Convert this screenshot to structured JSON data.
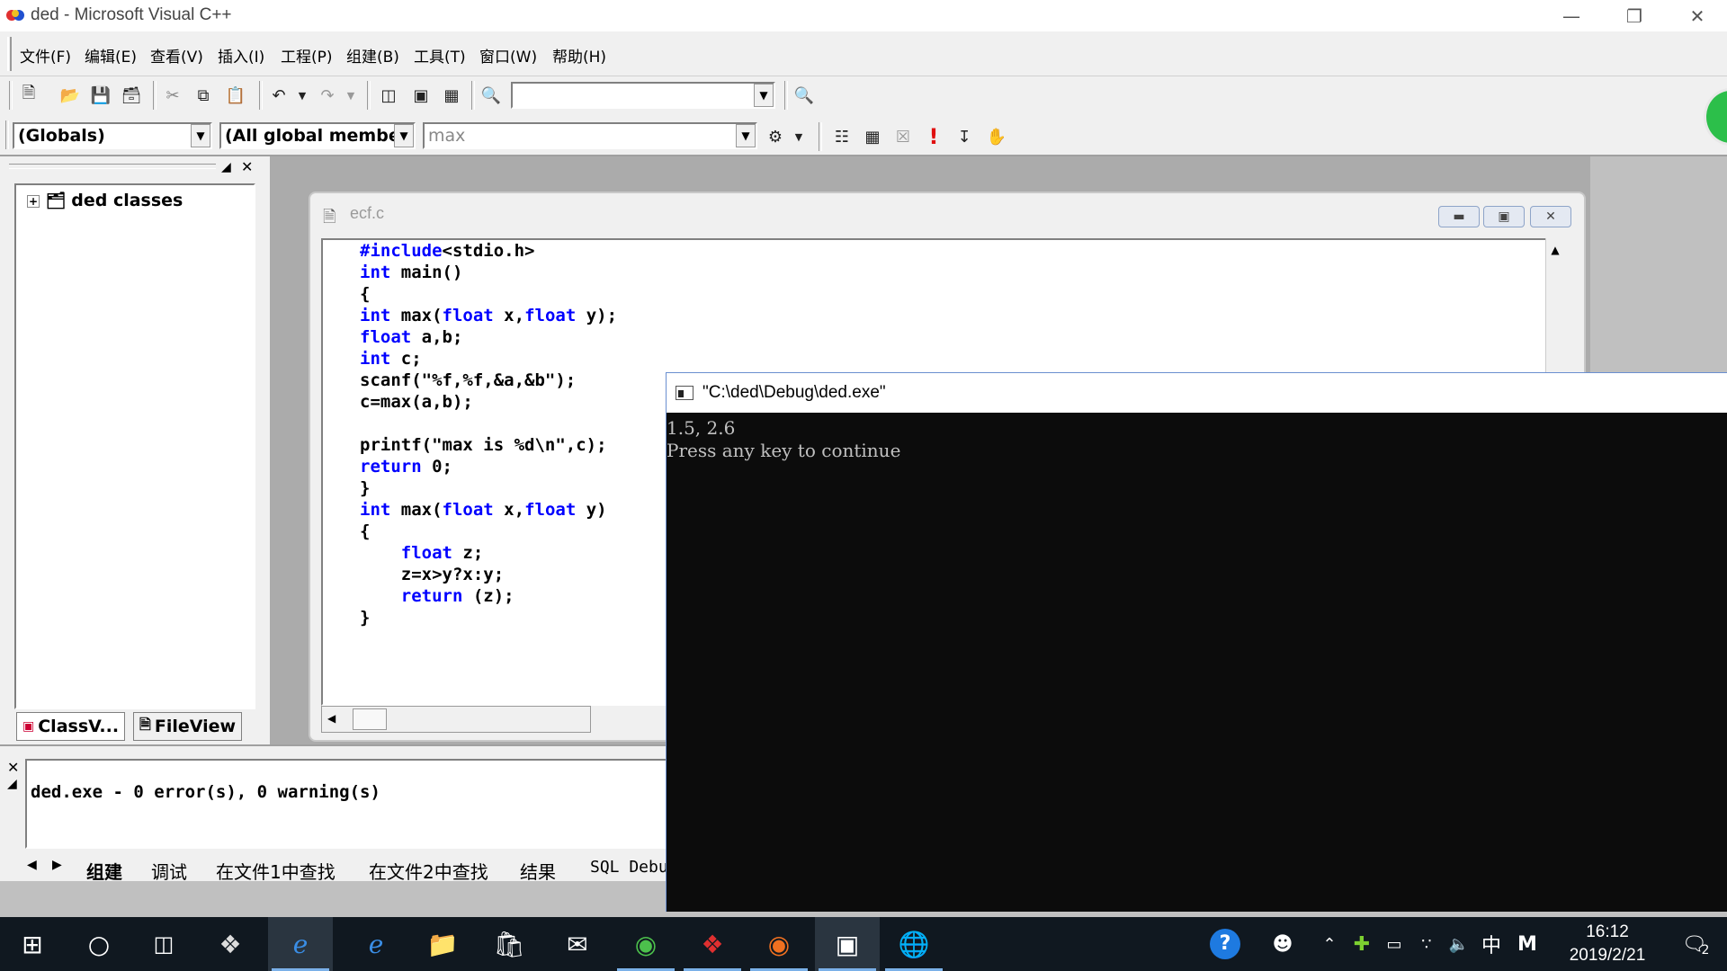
{
  "window": {
    "title": "ded - Microsoft Visual C++"
  },
  "menu": {
    "items": [
      "文件(F)",
      "编辑(E)",
      "查看(V)",
      "插入(I)",
      "工程(P)",
      "组建(B)",
      "工具(T)",
      "窗口(W)",
      "帮助(H)"
    ]
  },
  "toolbar": {
    "combo_globals": "(Globals)",
    "combo_members": "(All global members",
    "combo_function": "max"
  },
  "workspace": {
    "root": "ded classes",
    "tab_classview": "ClassV...",
    "tab_fileview": "FileView"
  },
  "editor": {
    "title": "ecf.c",
    "lines": [
      [
        {
          "t": "#include",
          "k": true
        },
        {
          "t": "<stdio.h>"
        }
      ],
      [
        {
          "t": "int",
          "k": true
        },
        {
          "t": " main()"
        }
      ],
      [
        {
          "t": "{"
        }
      ],
      [
        {
          "t": "int",
          "k": true
        },
        {
          "t": " max("
        },
        {
          "t": "float",
          "k": true
        },
        {
          "t": " x,"
        },
        {
          "t": "float",
          "k": true
        },
        {
          "t": " y);"
        }
      ],
      [
        {
          "t": "float",
          "k": true
        },
        {
          "t": " a,b;"
        }
      ],
      [
        {
          "t": "int",
          "k": true
        },
        {
          "t": " c;"
        }
      ],
      [
        {
          "t": "scanf(\"%f,%f,&a,&b\");"
        }
      ],
      [
        {
          "t": "c=max(a,b);"
        }
      ],
      [
        {
          "t": ""
        }
      ],
      [
        {
          "t": "printf(\"max is %d\\n\",c);"
        }
      ],
      [
        {
          "t": "return",
          "k": true
        },
        {
          "t": " 0;"
        }
      ],
      [
        {
          "t": "}"
        }
      ],
      [
        {
          "t": "int",
          "k": true
        },
        {
          "t": " max("
        },
        {
          "t": "float",
          "k": true
        },
        {
          "t": " x,"
        },
        {
          "t": "float",
          "k": true
        },
        {
          "t": " y)"
        }
      ],
      [
        {
          "t": "{"
        }
      ],
      [
        {
          "t": "    "
        },
        {
          "t": "float",
          "k": true
        },
        {
          "t": " z;"
        }
      ],
      [
        {
          "t": "    z=x>y?x:y;"
        }
      ],
      [
        {
          "t": "    "
        },
        {
          "t": "return",
          "k": true
        },
        {
          "t": " (z);"
        }
      ],
      [
        {
          "t": "}"
        }
      ]
    ]
  },
  "output": {
    "message": "ded.exe - 0 error(s), 0 warning(s)",
    "tabs": [
      "组建",
      "调试",
      "在文件1中查找",
      "在文件2中查找",
      "结果",
      "SQL Debu"
    ]
  },
  "console": {
    "title": "\"C:\\ded\\Debug\\ded.exe\"",
    "line1": "1.5, 2.6",
    "line2": "Press any key to continue"
  },
  "taskbar": {
    "time": "16:12",
    "date": "2019/2/21",
    "ime": "中",
    "notifications": "2"
  }
}
